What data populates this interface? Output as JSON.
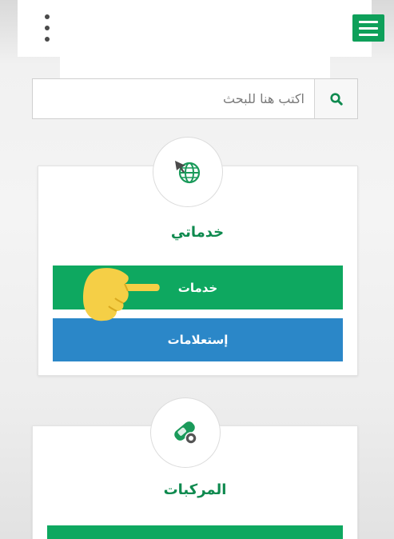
{
  "header": {
    "menu_icon": "hamburger-menu-icon",
    "more_icon": "kebab-more-icon",
    "accent": "#0ea05a"
  },
  "search": {
    "placeholder": "اكتب هنا للبحث",
    "icon": "search-icon",
    "icon_color": "#0f8a4f"
  },
  "cards": [
    {
      "title": "خدماتي",
      "icon": "globe-cursor-icon",
      "buttons": [
        {
          "label": "خدمات",
          "color": "#0ea860"
        },
        {
          "label": "إستعلامات",
          "color": "#2b87c8"
        }
      ]
    },
    {
      "title": "المركبات",
      "icon": "vehicle-settings-icon",
      "buttons": [
        {
          "label": "",
          "color": "#0ea860"
        }
      ]
    }
  ],
  "overlay": {
    "pointer_icon": "pointing-hand-icon",
    "color": "#f5cf46"
  }
}
